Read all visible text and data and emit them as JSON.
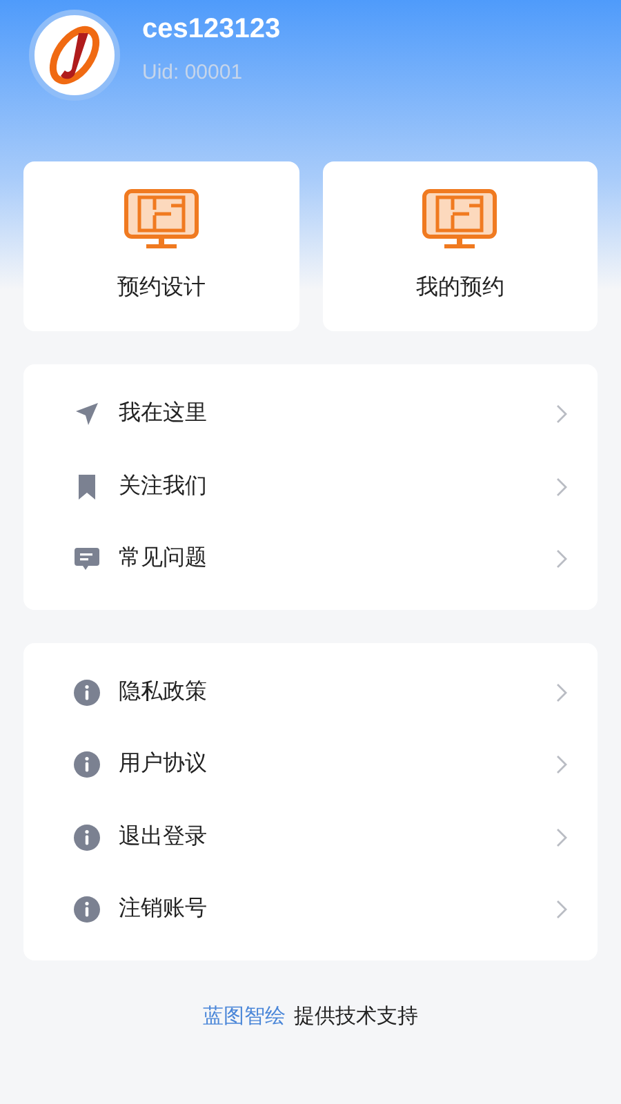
{
  "profile": {
    "name": "ces123123",
    "uid": "Uid: 00001"
  },
  "shortcuts": [
    {
      "label": "预约设计"
    },
    {
      "label": "我的预约"
    }
  ],
  "menu_groups": [
    [
      {
        "label": "我在这里",
        "kind": "send"
      },
      {
        "label": "关注我们",
        "kind": "bookmark"
      },
      {
        "label": "常见问题",
        "kind": "message"
      }
    ],
    [
      {
        "label": "隐私政策",
        "kind": "info"
      },
      {
        "label": "用户协议",
        "kind": "info"
      },
      {
        "label": "退出登录",
        "kind": "info"
      },
      {
        "label": "注销账号",
        "kind": "info"
      }
    ]
  ],
  "footer": {
    "brand": "蓝图智绘",
    "text": "提供技术支持"
  }
}
